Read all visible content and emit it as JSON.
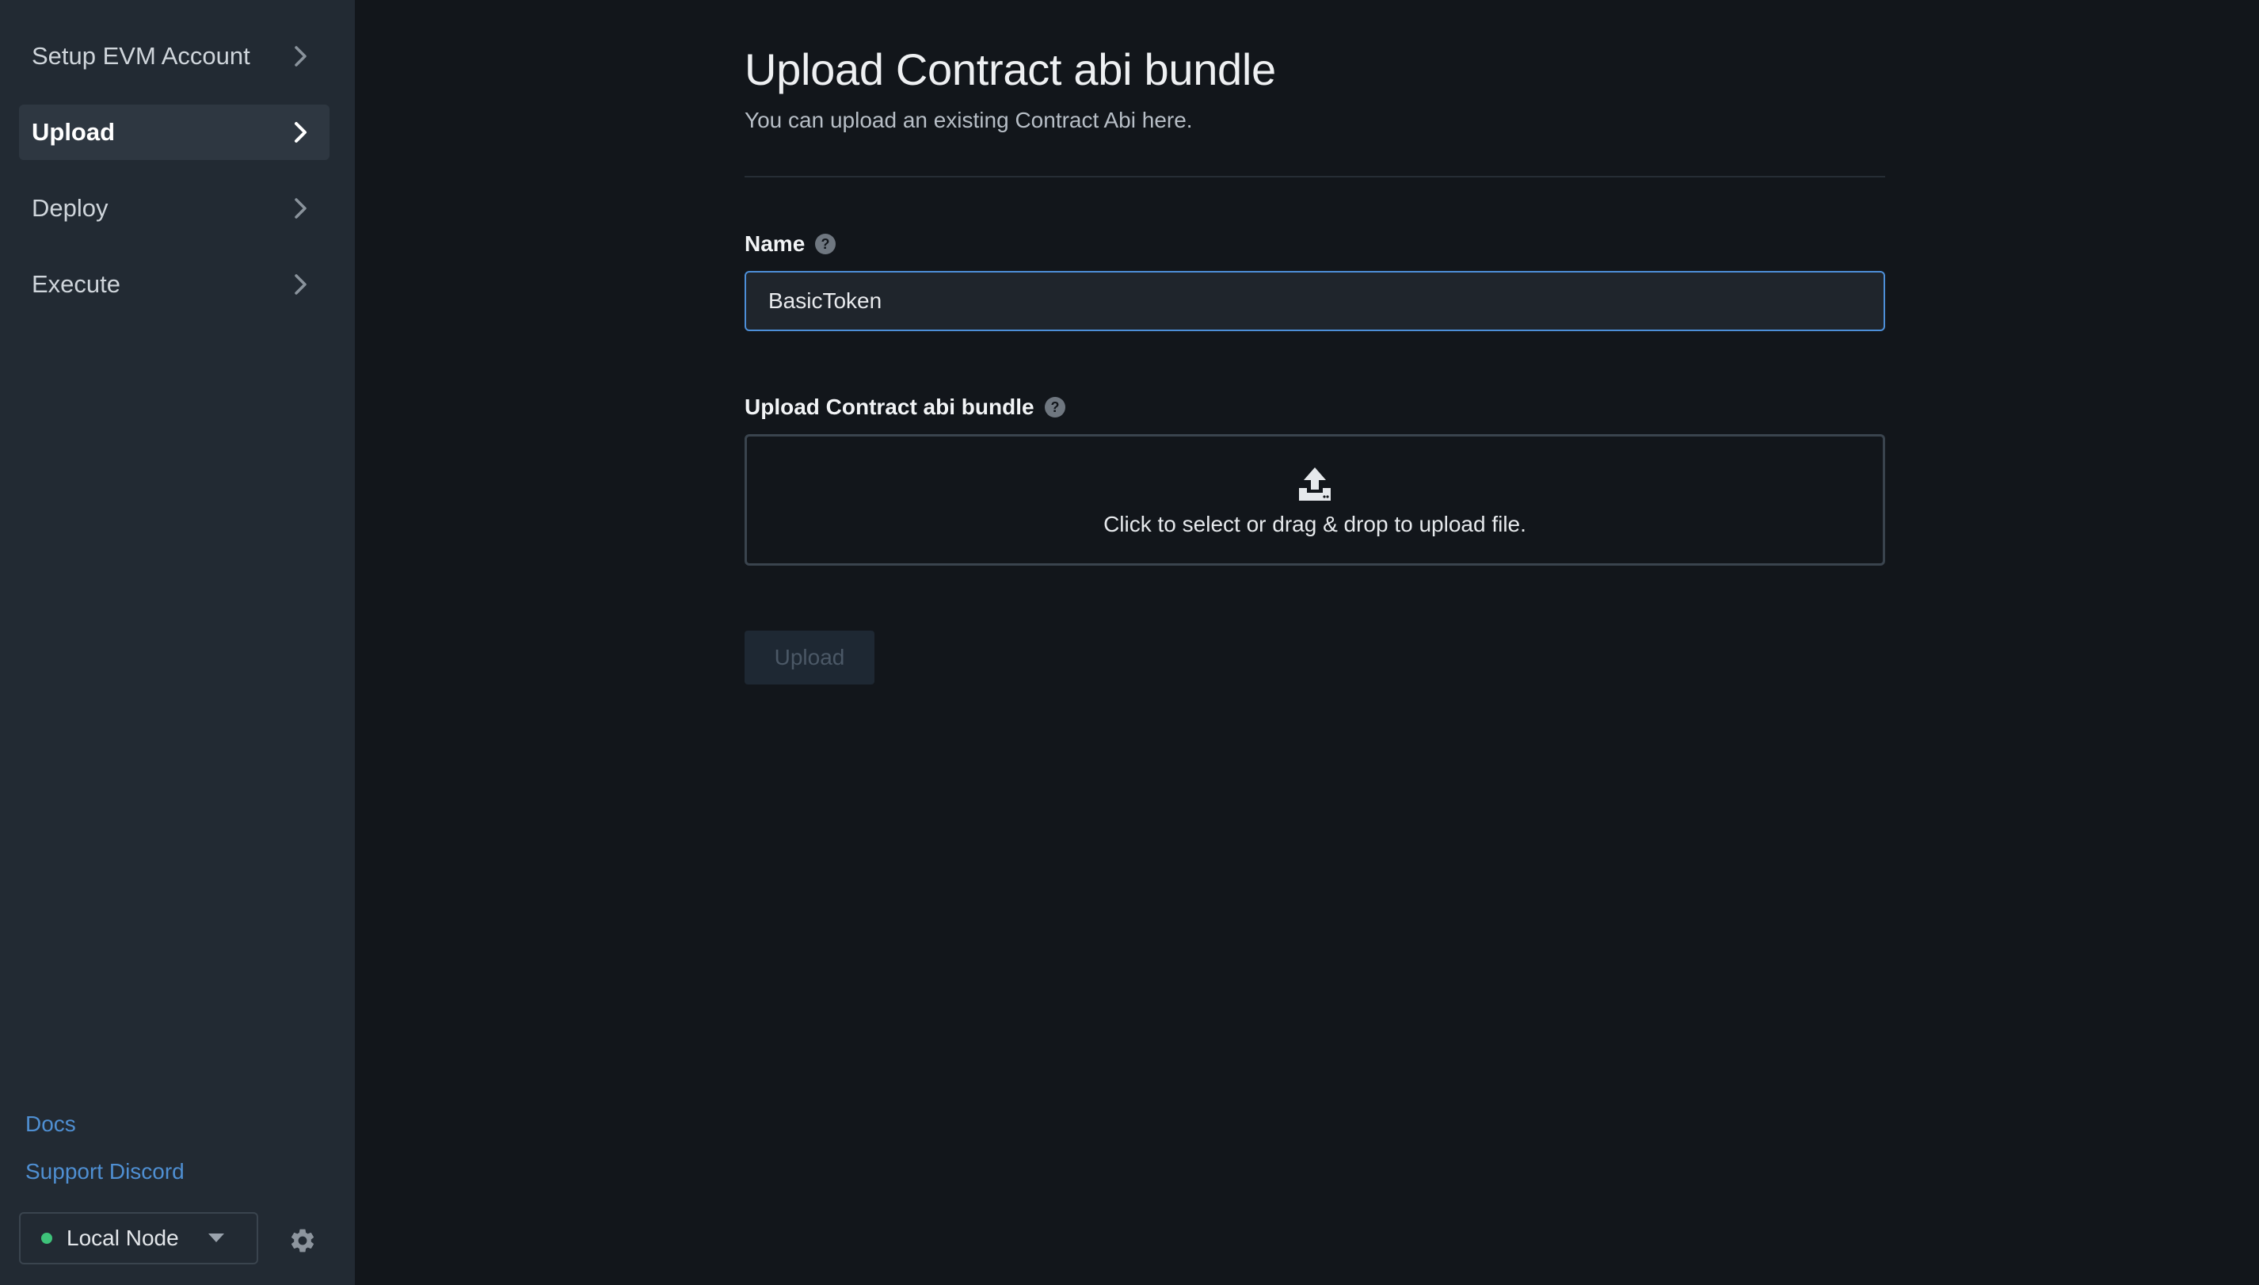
{
  "sidebar": {
    "items": [
      {
        "label": "Setup EVM Account",
        "active": false
      },
      {
        "label": "Upload",
        "active": true
      },
      {
        "label": "Deploy",
        "active": false
      },
      {
        "label": "Execute",
        "active": false
      }
    ],
    "links": {
      "docs": "Docs",
      "support": "Support Discord"
    },
    "node": {
      "label": "Local Node",
      "status_color": "#3ec37a"
    },
    "settings_icon": "gear-icon"
  },
  "page": {
    "title": "Upload Contract abi bundle",
    "subtitle": "You can upload an existing Contract Abi here."
  },
  "form": {
    "name": {
      "label": "Name",
      "value": "BasicToken"
    },
    "upload": {
      "label": "Upload Contract abi bundle",
      "dropzone_text": "Click to select or drag & drop to upload file."
    },
    "submit_label": "Upload"
  },
  "colors": {
    "accent": "#4d8fd8",
    "sidebar_bg": "#222a33",
    "main_bg": "#12161b",
    "link": "#4f8fd2"
  }
}
